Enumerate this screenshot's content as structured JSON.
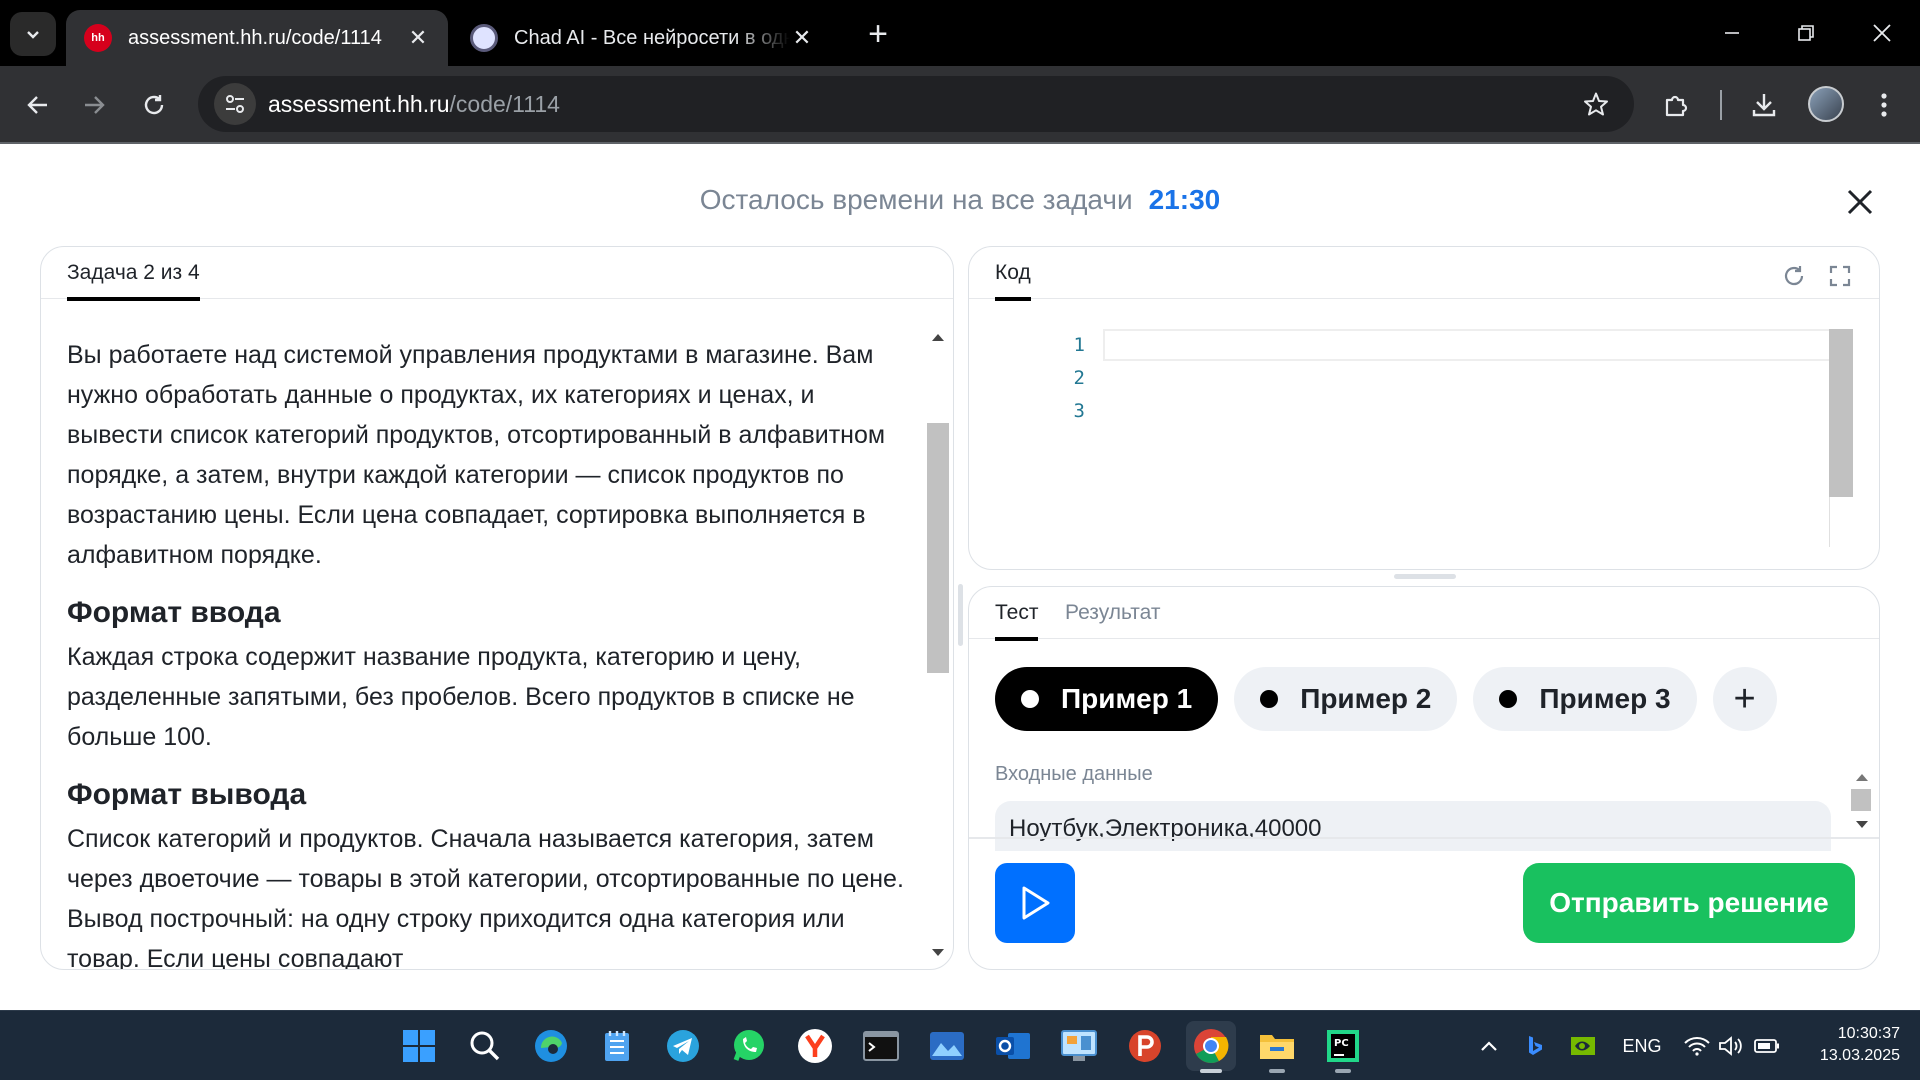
{
  "browser": {
    "tabs": [
      {
        "title": "assessment.hh.ru/code/1114",
        "favicon": "hh",
        "active": true
      },
      {
        "title": "Chad AI - Все нейросети в одном",
        "favicon": "chad",
        "active": false
      }
    ],
    "url_host": "assessment.hh.ru",
    "url_path": "/code/1114"
  },
  "timer": {
    "label": "Осталось времени на все задачи",
    "value": "21:30"
  },
  "task": {
    "tab_label": "Задача 2 из 4",
    "intro": "Вы работаете над системой управления продуктами в магазине. Вам нужно обработать данные о продуктах, их категориях и ценах, и вывести список категорий продуктов, отсортированный в алфавитном порядке, а затем, внутри каждой категории — список продуктов по возрастанию цены. Если цена совпадает, сортировка выполняется в алфавитном порядке.",
    "input_heading": "Формат ввода",
    "input_text": "Каждая строка содержит название продукта, категорию и цену, разделенные запятыми, без пробелов. Всего продуктов в списке не больше 100.",
    "output_heading": "Формат вывода",
    "output_text": "Список категорий и продуктов. Сначала называется категория, затем через двоеточие — товары в этой категории, отсортированные по цене. Вывод построчный: на одну строку приходится одна категория или товар. Если цены совпадают"
  },
  "code": {
    "tab_label": "Код",
    "line_numbers": [
      "1",
      "2",
      "3"
    ]
  },
  "tests": {
    "tab_test": "Тест",
    "tab_result": "Результат",
    "examples": [
      "Пример 1",
      "Пример 2",
      "Пример 3"
    ],
    "add_label": "+",
    "input_label": "Входные данные",
    "input_first_line": "Ноутбук,Электроника,40000",
    "submit_label": "Отправить решение"
  },
  "taskbar": {
    "language": "ENG",
    "time": "10:30:37",
    "date": "13.03.2025"
  },
  "colors": {
    "accent_blue": "#0070ff",
    "submit_green": "#19c15f",
    "timer_blue": "#1a73e8"
  }
}
